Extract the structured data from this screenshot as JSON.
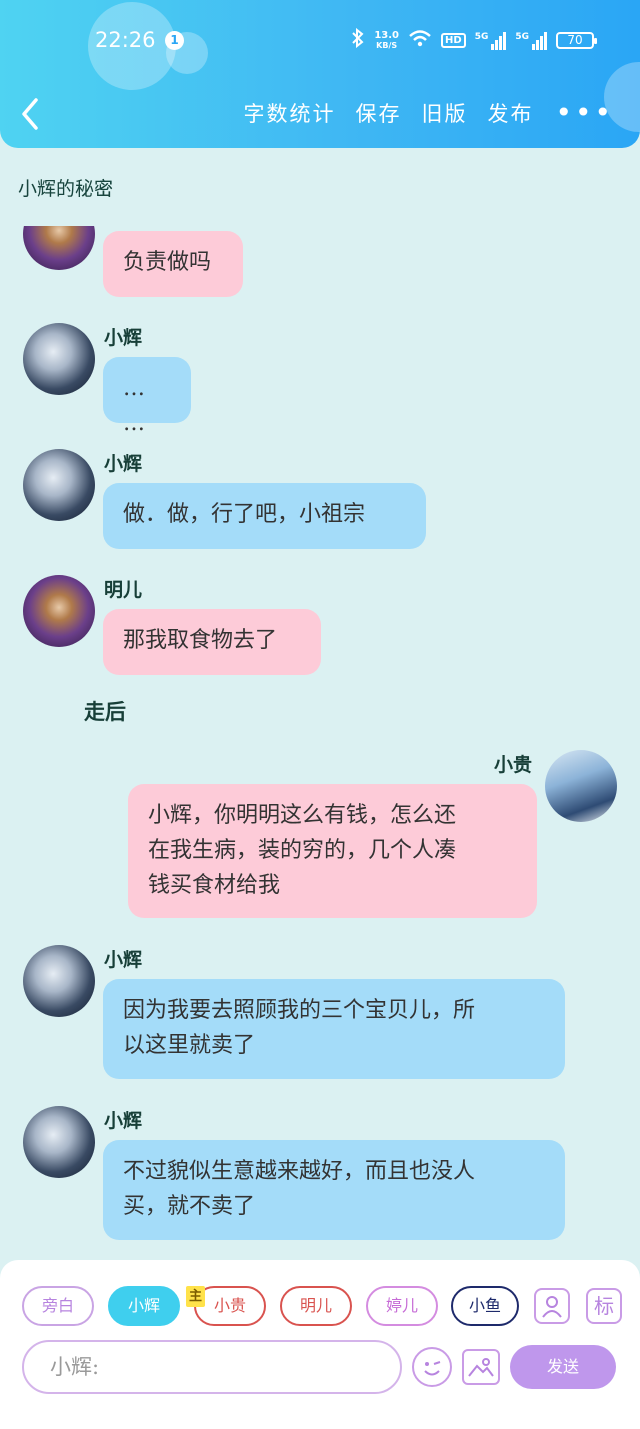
{
  "status_bar": {
    "time": "22:26",
    "notification_count": "1",
    "net_speed_value": "13.0",
    "net_speed_unit": "KB/S",
    "hd_label": "HD",
    "sim1_label": "5G",
    "sim2_label": "5G",
    "battery": "70"
  },
  "nav": {
    "word_count": "字数统计",
    "save": "保存",
    "old_version": "旧版",
    "publish": "发布",
    "more": "•••"
  },
  "story_title": "小辉的秘密",
  "messages": [
    {
      "speaker": "",
      "text": "负责做吗",
      "avatar": "ming"
    },
    {
      "speaker": "小辉",
      "text": "… …",
      "avatar": "hui"
    },
    {
      "speaker": "小辉",
      "text": "做．做，行了吧，小祖宗",
      "avatar": "hui"
    },
    {
      "speaker": "明儿",
      "text": "那我取食物去了",
      "avatar": "ming"
    },
    {
      "speaker": "小贵",
      "line1": "小辉，你明明这么有钱，怎么还",
      "line2": "在我生病，装的穷的，几个人凑",
      "line3": "钱买食材给我",
      "avatar": "gui"
    },
    {
      "speaker": "小辉",
      "line1": "因为我要去照顾我的三个宝贝儿，所",
      "line2": "以这里就卖了",
      "avatar": "hui"
    },
    {
      "speaker": "小辉",
      "line1": "不过貌似生意越来越好，而且也没人",
      "line2": "买，就不卖了",
      "avatar": "hui"
    }
  ],
  "narration": "走后",
  "characters": [
    {
      "label": "旁白",
      "color": "#c9a4e4",
      "text_color": "#b784df"
    },
    {
      "label": "小辉",
      "color": "#3fcfee",
      "text_color": "#ffffff"
    },
    {
      "label": "小贵",
      "color": "#d9534f",
      "text_color": "#d9534f"
    },
    {
      "label": "明儿",
      "color": "#d9534f",
      "text_color": "#d9534f"
    },
    {
      "label": "婷儿",
      "color": "#d48ce0",
      "text_color": "#c66bd6"
    },
    {
      "label": "小鱼",
      "color": "#1e2a6b",
      "text_color": "#1e2a6b"
    }
  ],
  "owner_tag": "主",
  "tools": {
    "add_character_icon": "person-icon",
    "tag_label": "标"
  },
  "input": {
    "placeholder": "小辉:"
  },
  "send_label": "发送",
  "colors": {
    "header_start": "#4fd3f2",
    "header_end": "#2aa6f5",
    "background": "#dbf1f2",
    "blue_bubble": "#a4dcf9",
    "pink_bubble": "#fdcbd8",
    "send_button": "#bf97ec"
  }
}
